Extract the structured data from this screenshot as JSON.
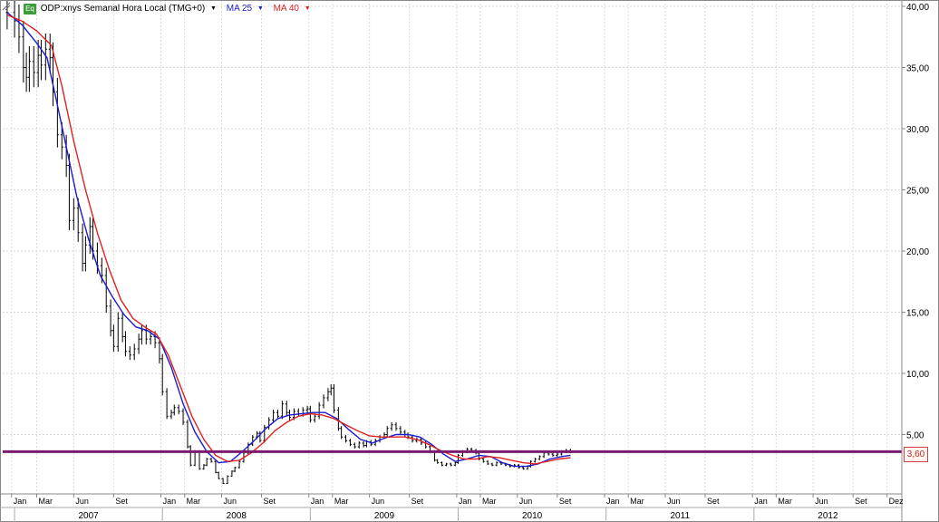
{
  "header": {
    "badge": "Eq",
    "symbol": "ODP:xnys Semanal Hora Local (TMG+0)",
    "ma25_label": "MA 25",
    "ma40_label": "MA 40",
    "dropdown_arrow": "▼"
  },
  "colors": {
    "price": "#000000",
    "ma25": "#1c1ccf",
    "ma40": "#e02020",
    "hline": "#7b1a6e",
    "grid": "#d9d9d9",
    "badge": "#3c9a3c"
  },
  "chart_data": {
    "type": "line",
    "title": "ODP:xnys Semanal Hora Local (TMG+0)",
    "xlabel": "",
    "ylabel": "",
    "ylim": [
      0,
      40
    ],
    "grid": true,
    "y_ticks": [
      "5,00",
      "10,00",
      "15,00",
      "20,00",
      "25,00",
      "30,00",
      "35,00",
      "40,00"
    ],
    "x_tick_labels": [
      {
        "t": 2006.98,
        "label": "Jan"
      },
      {
        "t": 2007.15,
        "label": "Mar"
      },
      {
        "t": 2007.4,
        "label": "Jun"
      },
      {
        "t": 2007.67,
        "label": "Set"
      },
      {
        "t": 2007.99,
        "label": "Jan"
      },
      {
        "t": 2008.15,
        "label": "Mar"
      },
      {
        "t": 2008.4,
        "label": "Jun"
      },
      {
        "t": 2008.67,
        "label": "Set"
      },
      {
        "t": 2008.99,
        "label": "Jan"
      },
      {
        "t": 2009.15,
        "label": "Mar"
      },
      {
        "t": 2009.4,
        "label": "Jun"
      },
      {
        "t": 2009.67,
        "label": "Set"
      },
      {
        "t": 2009.99,
        "label": "Jan"
      },
      {
        "t": 2010.15,
        "label": "Mar"
      },
      {
        "t": 2010.4,
        "label": "Jun"
      },
      {
        "t": 2010.67,
        "label": "Set"
      },
      {
        "t": 2010.99,
        "label": "Jan"
      },
      {
        "t": 2011.15,
        "label": "Mar"
      },
      {
        "t": 2011.4,
        "label": "Jun"
      },
      {
        "t": 2011.67,
        "label": "Set"
      },
      {
        "t": 2011.99,
        "label": "Jan"
      },
      {
        "t": 2012.15,
        "label": "Mar"
      },
      {
        "t": 2012.4,
        "label": "Jun"
      },
      {
        "t": 2012.67,
        "label": "Set"
      },
      {
        "t": 2012.9,
        "label": "Dez"
      }
    ],
    "years": [
      {
        "label": "2007",
        "start": 2007.0,
        "end": 2008.0
      },
      {
        "label": "2008",
        "start": 2008.0,
        "end": 2009.0
      },
      {
        "label": "2009",
        "start": 2009.0,
        "end": 2010.0
      },
      {
        "label": "2010",
        "start": 2010.0,
        "end": 2011.0
      },
      {
        "label": "2011",
        "start": 2011.0,
        "end": 2012.0
      },
      {
        "label": "2012",
        "start": 2012.0,
        "end": 2013.0
      }
    ],
    "x_range": [
      2006.92,
      2013.0
    ],
    "series": [
      {
        "name": "ODP:xnys",
        "style": "ohlc",
        "points": [
          [
            2006.95,
            39.5
          ],
          [
            2007.0,
            38.8
          ],
          [
            2007.03,
            37.5
          ],
          [
            2007.06,
            35.0
          ],
          [
            2007.08,
            34.2
          ],
          [
            2007.1,
            35.5
          ],
          [
            2007.13,
            34.6
          ],
          [
            2007.16,
            36.0
          ],
          [
            2007.18,
            35.2
          ],
          [
            2007.21,
            36.5
          ],
          [
            2007.24,
            35.8
          ],
          [
            2007.26,
            33.0
          ],
          [
            2007.29,
            29.5
          ],
          [
            2007.32,
            28.5
          ],
          [
            2007.35,
            27.0
          ],
          [
            2007.37,
            22.5
          ],
          [
            2007.4,
            23.5
          ],
          [
            2007.43,
            21.5
          ],
          [
            2007.46,
            19.0
          ],
          [
            2007.48,
            20.5
          ],
          [
            2007.51,
            22.0
          ],
          [
            2007.53,
            20.0
          ],
          [
            2007.56,
            18.8
          ],
          [
            2007.59,
            18.0
          ],
          [
            2007.62,
            15.5
          ],
          [
            2007.65,
            13.5
          ],
          [
            2007.67,
            12.2
          ],
          [
            2007.7,
            14.5
          ],
          [
            2007.73,
            13.0
          ],
          [
            2007.75,
            11.8
          ],
          [
            2007.78,
            11.5
          ],
          [
            2007.81,
            12.0
          ],
          [
            2007.84,
            12.8
          ],
          [
            2007.86,
            13.5
          ],
          [
            2007.89,
            12.8
          ],
          [
            2007.92,
            13.0
          ],
          [
            2007.95,
            12.5
          ],
          [
            2007.98,
            11.2
          ],
          [
            2008.0,
            8.5
          ],
          [
            2008.03,
            6.5
          ],
          [
            2008.06,
            6.8
          ],
          [
            2008.08,
            7.2
          ],
          [
            2008.11,
            6.9
          ],
          [
            2008.14,
            6.0
          ],
          [
            2008.17,
            4.0
          ],
          [
            2008.19,
            2.5
          ],
          [
            2008.22,
            3.6
          ],
          [
            2008.25,
            2.2
          ],
          [
            2008.28,
            2.5
          ],
          [
            2008.3,
            3.0
          ],
          [
            2008.33,
            2.8
          ],
          [
            2008.36,
            1.9
          ],
          [
            2008.38,
            1.4
          ],
          [
            2008.41,
            1.0
          ],
          [
            2008.44,
            1.6
          ],
          [
            2008.47,
            2.0
          ],
          [
            2008.49,
            2.3
          ],
          [
            2008.52,
            2.8
          ],
          [
            2008.55,
            3.5
          ],
          [
            2008.58,
            4.2
          ],
          [
            2008.61,
            4.8
          ],
          [
            2008.64,
            5.1
          ],
          [
            2008.66,
            4.5
          ],
          [
            2008.69,
            5.6
          ],
          [
            2008.72,
            6.2
          ],
          [
            2008.75,
            6.8
          ],
          [
            2008.78,
            6.5
          ],
          [
            2008.81,
            7.5
          ],
          [
            2008.84,
            6.8
          ],
          [
            2008.86,
            6.4
          ],
          [
            2008.89,
            6.9
          ],
          [
            2008.92,
            6.7
          ],
          [
            2008.95,
            7.0
          ],
          [
            2008.98,
            7.1
          ],
          [
            2009.0,
            6.2
          ],
          [
            2009.03,
            6.5
          ],
          [
            2009.06,
            7.4
          ],
          [
            2009.09,
            8.0
          ],
          [
            2009.12,
            8.5
          ],
          [
            2009.14,
            8.8
          ],
          [
            2009.16,
            7.0
          ],
          [
            2009.19,
            5.5
          ],
          [
            2009.21,
            4.8
          ],
          [
            2009.24,
            4.5
          ],
          [
            2009.27,
            4.2
          ],
          [
            2009.3,
            4.0
          ],
          [
            2009.33,
            4.3
          ],
          [
            2009.36,
            4.1
          ],
          [
            2009.38,
            4.4
          ],
          [
            2009.41,
            4.2
          ],
          [
            2009.44,
            4.5
          ],
          [
            2009.47,
            4.8
          ],
          [
            2009.5,
            5.0
          ],
          [
            2009.52,
            5.5
          ],
          [
            2009.55,
            5.8
          ],
          [
            2009.58,
            5.5
          ],
          [
            2009.61,
            5.2
          ],
          [
            2009.64,
            5.0
          ],
          [
            2009.66,
            4.8
          ],
          [
            2009.69,
            4.5
          ],
          [
            2009.72,
            4.6
          ],
          [
            2009.75,
            4.3
          ],
          [
            2009.78,
            4.0
          ],
          [
            2009.81,
            3.6
          ],
          [
            2009.84,
            2.9
          ],
          [
            2009.86,
            2.7
          ],
          [
            2009.89,
            2.5
          ],
          [
            2009.92,
            2.6
          ],
          [
            2009.95,
            2.5
          ],
          [
            2009.98,
            2.7
          ],
          [
            2010.0,
            3.3
          ],
          [
            2010.03,
            3.6
          ],
          [
            2010.06,
            3.8
          ],
          [
            2010.09,
            3.7
          ],
          [
            2010.12,
            3.5
          ],
          [
            2010.14,
            3.0
          ],
          [
            2010.17,
            2.8
          ],
          [
            2010.2,
            2.6
          ],
          [
            2010.23,
            2.5
          ],
          [
            2010.26,
            2.7
          ],
          [
            2010.29,
            2.6
          ],
          [
            2010.32,
            2.5
          ],
          [
            2010.35,
            2.4
          ],
          [
            2010.38,
            2.5
          ],
          [
            2010.41,
            2.3
          ],
          [
            2010.44,
            2.2
          ],
          [
            2010.47,
            2.4
          ],
          [
            2010.49,
            2.8
          ],
          [
            2010.52,
            3.0
          ],
          [
            2010.55,
            3.2
          ],
          [
            2010.58,
            3.5
          ],
          [
            2010.61,
            3.4
          ],
          [
            2010.64,
            3.3
          ],
          [
            2010.67,
            3.4
          ],
          [
            2010.7,
            3.6
          ],
          [
            2010.73,
            3.7
          ],
          [
            2010.76,
            3.6
          ]
        ]
      },
      {
        "name": "MA 25",
        "style": "line",
        "points": [
          [
            2006.95,
            39.5
          ],
          [
            2007.05,
            38.5
          ],
          [
            2007.15,
            37.0
          ],
          [
            2007.22,
            35.8
          ],
          [
            2007.28,
            32.5
          ],
          [
            2007.35,
            28.5
          ],
          [
            2007.42,
            24.5
          ],
          [
            2007.5,
            21.0
          ],
          [
            2007.58,
            18.0
          ],
          [
            2007.66,
            16.3
          ],
          [
            2007.74,
            14.8
          ],
          [
            2007.82,
            13.8
          ],
          [
            2007.9,
            13.5
          ],
          [
            2007.98,
            12.8
          ],
          [
            2008.06,
            10.5
          ],
          [
            2008.14,
            7.5
          ],
          [
            2008.22,
            5.2
          ],
          [
            2008.3,
            3.6
          ],
          [
            2008.38,
            2.7
          ],
          [
            2008.46,
            2.8
          ],
          [
            2008.54,
            3.6
          ],
          [
            2008.62,
            4.5
          ],
          [
            2008.7,
            5.5
          ],
          [
            2008.78,
            6.3
          ],
          [
            2008.86,
            6.6
          ],
          [
            2008.94,
            6.7
          ],
          [
            2009.02,
            6.8
          ],
          [
            2009.1,
            6.8
          ],
          [
            2009.18,
            6.3
          ],
          [
            2009.26,
            5.4
          ],
          [
            2009.34,
            4.6
          ],
          [
            2009.42,
            4.3
          ],
          [
            2009.5,
            4.7
          ],
          [
            2009.58,
            5.0
          ],
          [
            2009.66,
            5.0
          ],
          [
            2009.74,
            4.8
          ],
          [
            2009.82,
            4.2
          ],
          [
            2009.9,
            3.4
          ],
          [
            2009.98,
            2.8
          ],
          [
            2010.06,
            3.0
          ],
          [
            2010.14,
            3.3
          ],
          [
            2010.22,
            3.2
          ],
          [
            2010.3,
            2.7
          ],
          [
            2010.38,
            2.4
          ],
          [
            2010.46,
            2.4
          ],
          [
            2010.54,
            2.6
          ],
          [
            2010.62,
            3.0
          ],
          [
            2010.7,
            3.2
          ],
          [
            2010.76,
            3.3
          ]
        ]
      },
      {
        "name": "MA 40",
        "style": "line",
        "points": [
          [
            2006.95,
            39.3
          ],
          [
            2007.05,
            38.8
          ],
          [
            2007.15,
            38.0
          ],
          [
            2007.25,
            36.8
          ],
          [
            2007.32,
            33.5
          ],
          [
            2007.4,
            29.0
          ],
          [
            2007.48,
            25.0
          ],
          [
            2007.56,
            21.5
          ],
          [
            2007.64,
            18.5
          ],
          [
            2007.72,
            16.0
          ],
          [
            2007.8,
            14.5
          ],
          [
            2007.88,
            13.8
          ],
          [
            2007.96,
            13.2
          ],
          [
            2008.04,
            11.5
          ],
          [
            2008.12,
            9.0
          ],
          [
            2008.2,
            6.5
          ],
          [
            2008.28,
            4.6
          ],
          [
            2008.36,
            3.3
          ],
          [
            2008.44,
            2.8
          ],
          [
            2008.52,
            2.9
          ],
          [
            2008.6,
            3.5
          ],
          [
            2008.68,
            4.3
          ],
          [
            2008.76,
            5.3
          ],
          [
            2008.84,
            6.0
          ],
          [
            2008.92,
            6.5
          ],
          [
            2009.0,
            6.7
          ],
          [
            2009.08,
            6.6
          ],
          [
            2009.16,
            6.3
          ],
          [
            2009.24,
            5.8
          ],
          [
            2009.32,
            5.3
          ],
          [
            2009.4,
            4.9
          ],
          [
            2009.48,
            4.8
          ],
          [
            2009.56,
            4.8
          ],
          [
            2009.64,
            4.8
          ],
          [
            2009.72,
            4.6
          ],
          [
            2009.8,
            4.2
          ],
          [
            2009.88,
            3.7
          ],
          [
            2009.96,
            3.3
          ],
          [
            2010.04,
            3.0
          ],
          [
            2010.12,
            3.0
          ],
          [
            2010.2,
            3.2
          ],
          [
            2010.28,
            3.1
          ],
          [
            2010.36,
            2.9
          ],
          [
            2010.44,
            2.7
          ],
          [
            2010.52,
            2.6
          ],
          [
            2010.6,
            2.8
          ],
          [
            2010.68,
            3.0
          ],
          [
            2010.76,
            3.1
          ]
        ]
      }
    ],
    "hline": {
      "value": 3.6,
      "label": "3,60"
    }
  }
}
